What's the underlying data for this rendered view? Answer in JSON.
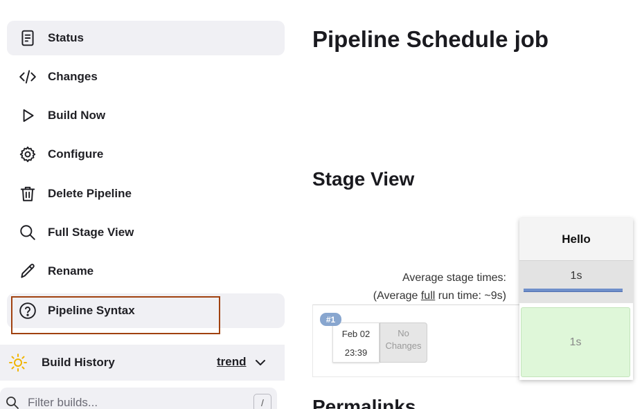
{
  "sidebar": {
    "items": [
      {
        "label": "Status",
        "icon": "document-icon"
      },
      {
        "label": "Changes",
        "icon": "code-icon"
      },
      {
        "label": "Build Now",
        "icon": "play-icon"
      },
      {
        "label": "Configure",
        "icon": "gear-icon"
      },
      {
        "label": "Delete Pipeline",
        "icon": "trash-icon"
      },
      {
        "label": "Full Stage View",
        "icon": "search-icon"
      },
      {
        "label": "Rename",
        "icon": "pencil-icon"
      },
      {
        "label": "Pipeline Syntax",
        "icon": "help-circle-icon"
      }
    ],
    "build_history": {
      "title": "Build History",
      "trend_label": "trend",
      "filter_placeholder": "Filter builds...",
      "shortcut_key": "/"
    }
  },
  "main": {
    "page_title": "Pipeline Schedule job",
    "stage_view_title": "Stage View",
    "permalinks_title": "Permalinks",
    "average_stage_times_label": "Average stage times:",
    "average_full_prefix": "(Average ",
    "average_full_link": "full",
    "average_full_suffix": " run time: ~9s)",
    "stages": [
      {
        "name": "Hello",
        "avg_time": "1s"
      }
    ],
    "builds": [
      {
        "number": "#1",
        "date": "Feb 02",
        "time": "23:39",
        "changes": "No Changes",
        "stage_times": [
          "1s"
        ]
      }
    ]
  },
  "colors": {
    "active_bg": "#f0f0f4",
    "highlight_border": "#a0410f",
    "success_cell": "#dff7d9",
    "build_badge": "#88a6cf",
    "avg_bar": "#6f8fca"
  }
}
